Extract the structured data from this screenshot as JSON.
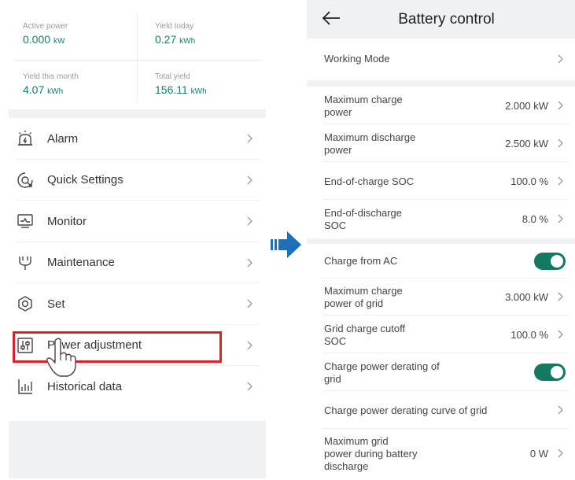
{
  "stats": {
    "active_power": {
      "label": "Active power",
      "value": "0.000",
      "unit": "kW"
    },
    "yield_today": {
      "label": "Yield today",
      "value": "0.27",
      "unit": "kWh"
    },
    "yield_month": {
      "label": "Yield this month",
      "value": "4.07",
      "unit": "kWh"
    },
    "total_yield": {
      "label": "Total yield",
      "value": "156.11",
      "unit": "kWh"
    }
  },
  "menu": {
    "items": [
      {
        "label": "Alarm",
        "icon": "alarm-icon"
      },
      {
        "label": "Quick Settings",
        "icon": "quick-settings-icon"
      },
      {
        "label": "Monitor",
        "icon": "monitor-icon"
      },
      {
        "label": "Maintenance",
        "icon": "maintenance-icon"
      },
      {
        "label": "Set",
        "icon": "settings-hex-icon"
      },
      {
        "label": "Power adjustment",
        "icon": "power-adjustment-icon"
      },
      {
        "label": "Historical data",
        "icon": "historical-data-icon"
      }
    ],
    "highlighted": "Power adjustment"
  },
  "battery": {
    "title": "Battery control",
    "working_mode": {
      "label": "Working Mode"
    },
    "max_charge_power": {
      "label_1": "Maximum charge",
      "label_2": "power",
      "value": "2.000 kW"
    },
    "max_discharge_power": {
      "label_1": "Maximum discharge",
      "label_2": "power",
      "value": "2.500 kW"
    },
    "end_charge_soc": {
      "label": "End-of-charge SOC",
      "value": "100.0 %"
    },
    "end_discharge_soc": {
      "label_1": "End-of-discharge",
      "label_2": "SOC",
      "value": "8.0 %"
    },
    "charge_from_ac": {
      "label": "Charge from AC",
      "enabled": true
    },
    "max_charge_power_grid": {
      "label_1": "Maximum charge",
      "label_2": "power of grid",
      "value": "3.000 kW"
    },
    "grid_charge_cutoff_soc": {
      "label_1": "Grid charge cutoff",
      "label_2": "SOC",
      "value": "100.0 %"
    },
    "charge_power_derating": {
      "label_1": "Charge power derating of",
      "label_2": "grid",
      "enabled": true
    },
    "derating_curve": {
      "label": "Charge power derating curve of grid"
    },
    "max_grid_power_discharge": {
      "label_1": "Maximum grid",
      "label_2": "power during battery",
      "label_3": "discharge",
      "value": "0 W"
    }
  },
  "colors": {
    "accent": "#117a61",
    "value_green": "#11806b",
    "highlight_red": "#d8232a",
    "arrow_blue": "#1c6fb8"
  }
}
